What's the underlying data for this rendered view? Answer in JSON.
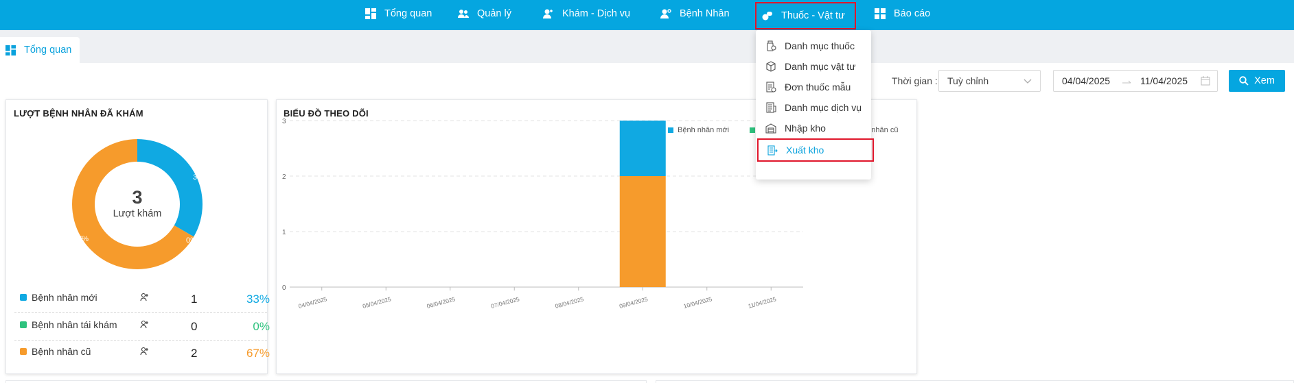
{
  "nav": {
    "items": [
      {
        "label": "Tổng quan"
      },
      {
        "label": "Quản lý"
      },
      {
        "label": "Khám - Dịch vụ"
      },
      {
        "label": "Bệnh Nhân"
      },
      {
        "label": "Thuốc - Vật tư"
      },
      {
        "label": "Báo cáo"
      }
    ]
  },
  "tabs": [
    {
      "label": "Tổng quan"
    }
  ],
  "dropdown": {
    "items": [
      {
        "label": "Danh mục thuốc"
      },
      {
        "label": "Danh mục vật tư"
      },
      {
        "label": "Đơn thuốc mẫu"
      },
      {
        "label": "Danh mục dịch vụ"
      },
      {
        "label": "Nhập kho"
      },
      {
        "label": "Xuất kho"
      }
    ]
  },
  "filters": {
    "time_label": "Thời gian :",
    "select_value": "Tuỳ chỉnh",
    "date_from": "04/04/2025",
    "date_to": "11/04/2025",
    "view_button": "Xem"
  },
  "patients_card": {
    "title": "LƯỢT BỆNH NHÂN ĐÃ KHÁM",
    "total": "3",
    "total_label": "Lượt khám",
    "rows": [
      {
        "label": "Bệnh nhân mới",
        "count": "1",
        "percent": "33%",
        "color": "#10a9e2"
      },
      {
        "label": "Bệnh nhân tái khám",
        "count": "0",
        "percent": "0%",
        "color": "#2ec27e"
      },
      {
        "label": "Bệnh nhân cũ",
        "count": "2",
        "percent": "67%",
        "color": "#f69b2c"
      }
    ],
    "slice_labels": [
      "33%",
      "0%",
      "67%"
    ]
  },
  "chart_card": {
    "title": "BIỂU ĐỒ THEO DÕI",
    "legend": [
      "Bệnh nhân mới",
      "nh nhân cũ"
    ]
  },
  "chart_data": [
    {
      "type": "pie",
      "title": "LƯỢT BỆNH NHÂN ĐÃ KHÁM",
      "categories": [
        "Bệnh nhân mới",
        "Bệnh nhân tái khám",
        "Bệnh nhân cũ"
      ],
      "values": [
        1,
        0,
        2
      ],
      "colors": [
        "#10a9e2",
        "#2ec27e",
        "#f69b2c"
      ],
      "donut": true
    },
    {
      "type": "bar",
      "stacked": true,
      "title": "BIỂU ĐỒ THEO DÕI",
      "categories": [
        "04/04/2025",
        "05/04/2025",
        "06/04/2025",
        "07/04/2025",
        "08/04/2025",
        "09/04/2025",
        "10/04/2025",
        "11/04/2025"
      ],
      "series": [
        {
          "name": "Bệnh nhân mới",
          "color": "#10a9e2",
          "values": [
            0,
            0,
            0,
            0,
            0,
            1,
            0,
            0
          ]
        },
        {
          "name": "",
          "color": "#2ec27e",
          "values": [
            0,
            0,
            0,
            0,
            0,
            0,
            0,
            0
          ]
        },
        {
          "name": "",
          "color": "#f69b2c",
          "values": [
            0,
            0,
            0,
            0,
            0,
            2,
            0,
            0
          ]
        }
      ],
      "ylim": [
        0,
        3
      ],
      "yticks": [
        "0",
        "1",
        "2",
        "3"
      ],
      "grid": true,
      "legend": "top-right"
    }
  ]
}
